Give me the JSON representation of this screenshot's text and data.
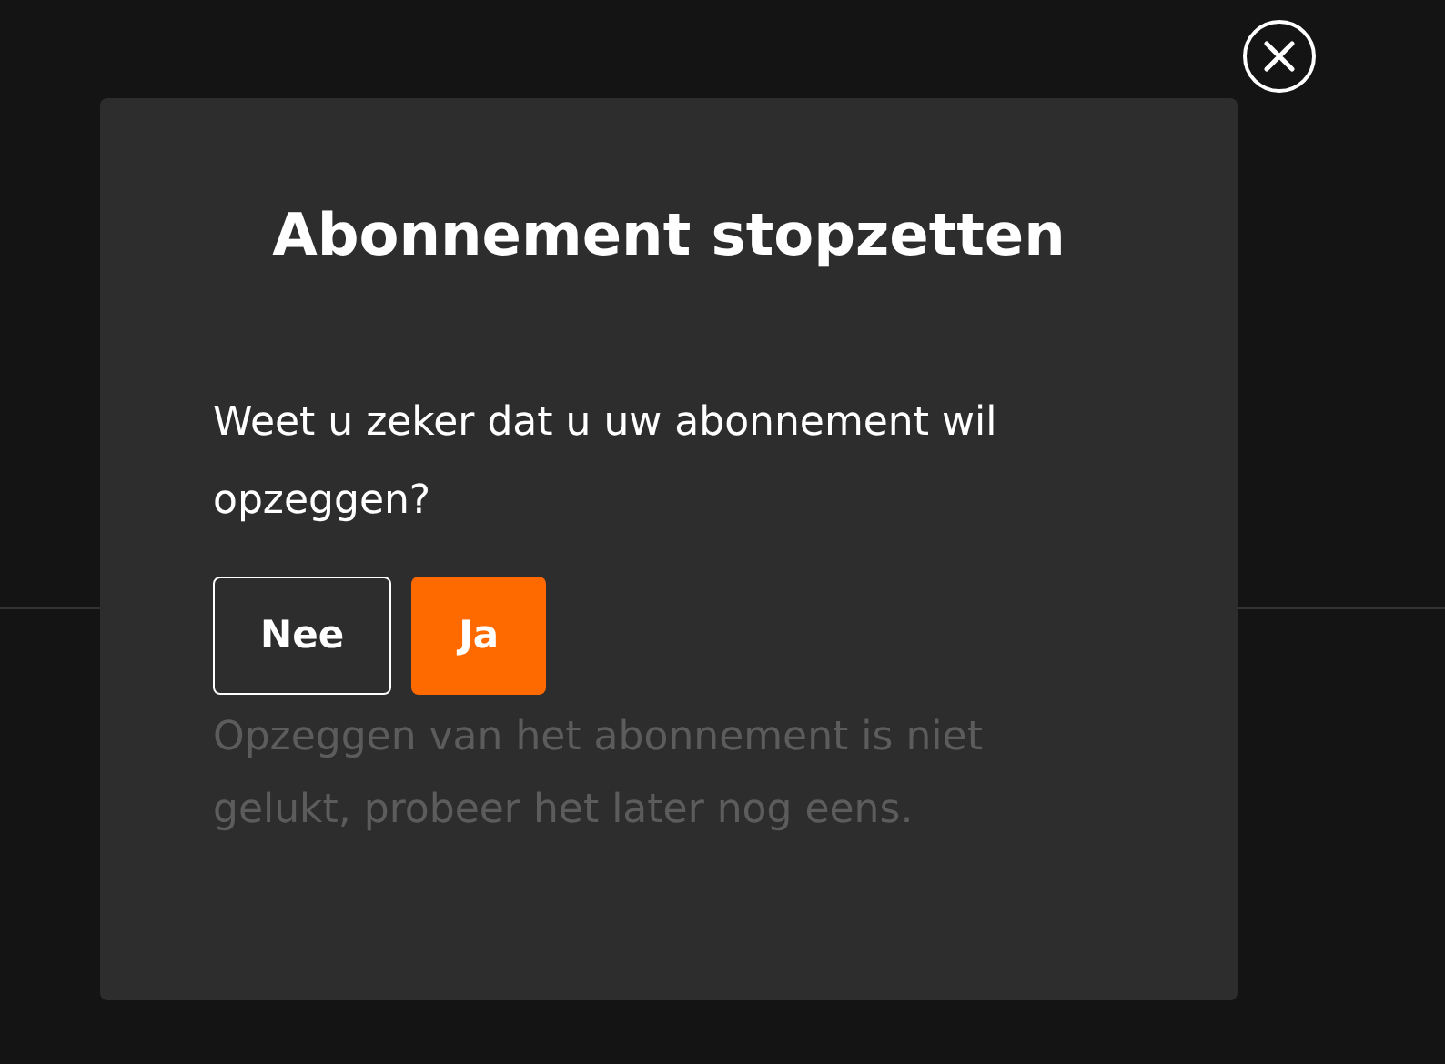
{
  "dialog": {
    "title": "Abonnement stopzetten",
    "message": "Weet u zeker dat u uw abonnement wil opzeggen?",
    "buttons": [
      {
        "label": "Nee",
        "kind": "secondary"
      },
      {
        "label": "Ja",
        "kind": "primary"
      }
    ],
    "error": "Opzeggen van het abonnement is niet gelukt, probeer het later nog eens."
  }
}
